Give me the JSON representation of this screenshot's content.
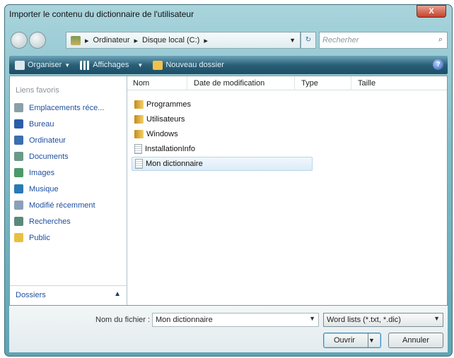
{
  "window": {
    "title": "Importer le contenu du dictionnaire de l'utilisateur",
    "close": "X"
  },
  "address": {
    "crumbs": [
      "Ordinateur",
      "Disque local (C:)"
    ],
    "search_placeholder": "Recherher"
  },
  "toolbar": {
    "organize": "Organiser",
    "views": "Affichages",
    "new_folder": "Nouveau dossier",
    "help": "?"
  },
  "sidebar": {
    "header": "Liens favoris",
    "items": [
      {
        "label": "Emplacements réce...",
        "color": "#8aa0a8"
      },
      {
        "label": "Bureau",
        "color": "#2a5fa8"
      },
      {
        "label": "Ordinateur",
        "color": "#3a6fb0"
      },
      {
        "label": "Documents",
        "color": "#6a9a88"
      },
      {
        "label": "Images",
        "color": "#4a9a6a"
      },
      {
        "label": "Musique",
        "color": "#2a7ab8"
      },
      {
        "label": "Modifié récemment",
        "color": "#8aa0b8"
      },
      {
        "label": "Recherches",
        "color": "#5a8a7a"
      },
      {
        "label": "Public",
        "color": "#e8c040"
      }
    ],
    "folders": "Dossiers"
  },
  "columns": [
    "Nom",
    "Date de modification",
    "Type",
    "Taille"
  ],
  "files": [
    {
      "name": "Programmes",
      "kind": "folder"
    },
    {
      "name": "Utilisateurs",
      "kind": "folder"
    },
    {
      "name": "Windows",
      "kind": "folder"
    },
    {
      "name": "InstallationInfo",
      "kind": "file"
    },
    {
      "name": "Mon dictionnaire",
      "kind": "file",
      "selected": true
    }
  ],
  "bottom": {
    "filename_label": "Nom du fichier :",
    "filename_value": "Mon dictionnaire",
    "filter": "Word lists (*.txt, *.dic)",
    "open": "Ouvrir",
    "cancel": "Annuler"
  }
}
